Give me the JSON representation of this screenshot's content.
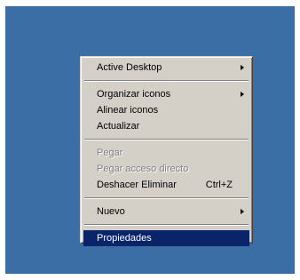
{
  "desktop": {
    "background_color": "#3a6ea5"
  },
  "context_menu": {
    "selection_color": "#0a246a",
    "items": [
      {
        "label": "Active Desktop",
        "submenu": true,
        "enabled": true
      },
      {
        "separator": true
      },
      {
        "label": "Organizar iconos",
        "submenu": true,
        "enabled": true
      },
      {
        "label": "Alinear iconos",
        "submenu": false,
        "enabled": true
      },
      {
        "label": "Actualizar",
        "submenu": false,
        "enabled": true
      },
      {
        "separator": true
      },
      {
        "label": "Pegar",
        "submenu": false,
        "enabled": false
      },
      {
        "label": "Pegar acceso directo",
        "submenu": false,
        "enabled": false
      },
      {
        "label": "Deshacer Eliminar",
        "shortcut": "Ctrl+Z",
        "submenu": false,
        "enabled": true
      },
      {
        "separator": true
      },
      {
        "label": "Nuevo",
        "submenu": true,
        "enabled": true
      },
      {
        "separator": true
      },
      {
        "label": "Propiedades",
        "submenu": false,
        "enabled": true,
        "selected": true
      }
    ]
  }
}
